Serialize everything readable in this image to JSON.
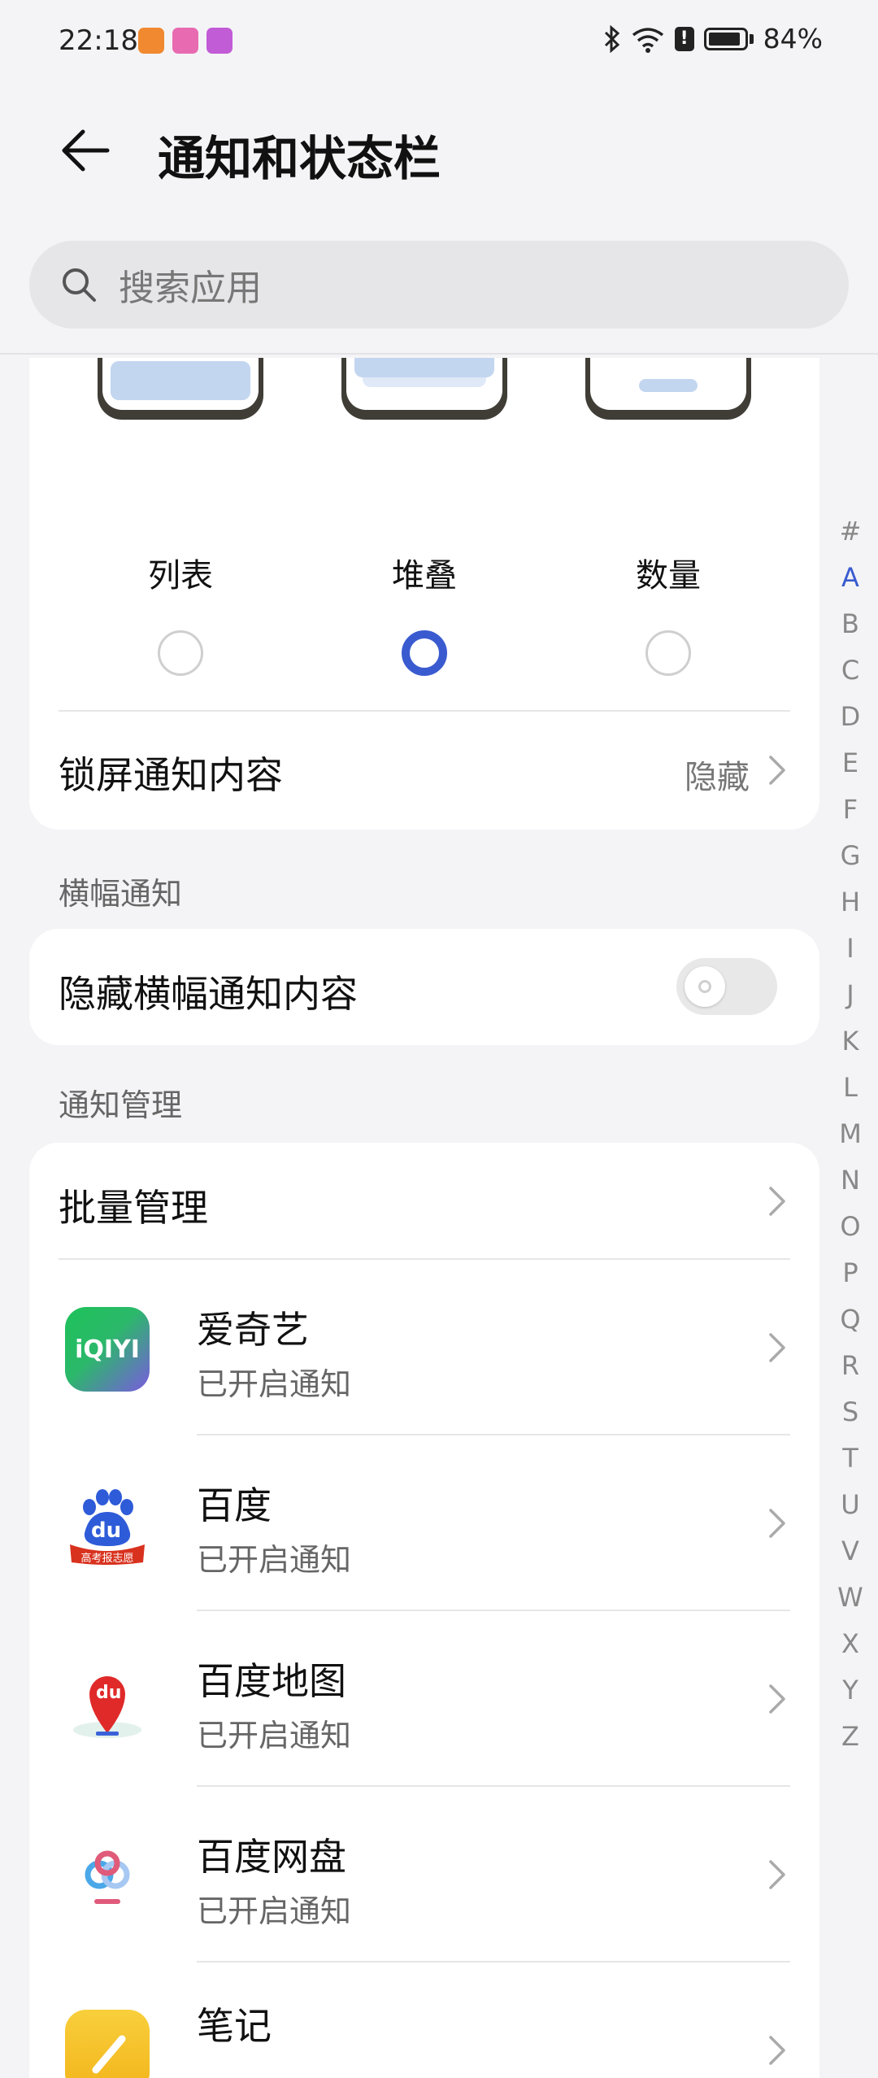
{
  "status_bar": {
    "time": "22:18",
    "battery": "84%",
    "network": "6"
  },
  "header": {
    "title": "通知和状态栏",
    "search_placeholder": "搜索应用"
  },
  "notification_style": {
    "options": [
      {
        "label": "列表",
        "selected": false
      },
      {
        "label": "堆叠",
        "selected": true
      },
      {
        "label": "数量",
        "selected": false
      }
    ]
  },
  "lock_screen": {
    "label": "锁屏通知内容",
    "value": "隐藏"
  },
  "banner_section": {
    "title": "横幅通知",
    "hide_banner_label": "隐藏横幅通知内容",
    "hide_banner_enabled": false
  },
  "management_section": {
    "title": "通知管理",
    "batch_label": "批量管理",
    "apps": [
      {
        "name": "爱奇艺",
        "status": "已开启通知",
        "icon": "iqiyi-icon"
      },
      {
        "name": "百度",
        "status": "已开启通知",
        "icon": "baidu-icon"
      },
      {
        "name": "百度地图",
        "status": "已开启通知",
        "icon": "baidu-map-icon"
      },
      {
        "name": "百度网盘",
        "status": "已开启通知",
        "icon": "baidu-netdisk-icon"
      },
      {
        "name": "笔记",
        "status": "",
        "icon": "notes-icon"
      }
    ]
  },
  "iqiyi_logo_text": "iQIYI",
  "baidu_logo_text": "du",
  "baidu_sub_text": "高考报志愿",
  "index_letters": [
    "#",
    "A",
    "B",
    "C",
    "D",
    "E",
    "F",
    "G",
    "H",
    "I",
    "J",
    "K",
    "L",
    "M",
    "N",
    "O",
    "P",
    "Q",
    "R",
    "S",
    "T",
    "U",
    "V",
    "W",
    "X",
    "Y",
    "Z"
  ],
  "colors": {
    "accent": "#3a5bd0",
    "bar": "#c3d6f0"
  }
}
